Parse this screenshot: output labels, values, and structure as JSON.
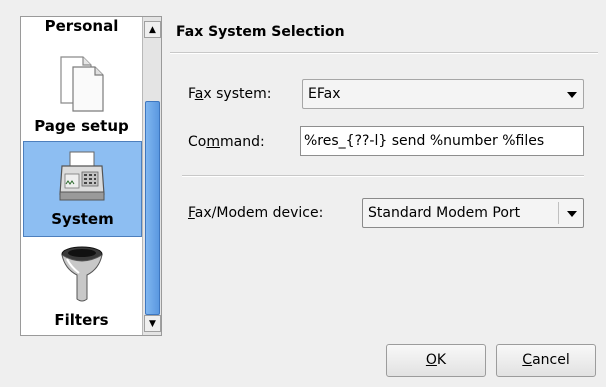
{
  "sidebar": {
    "items": [
      {
        "label": "Personal",
        "icon": "personal-icon"
      },
      {
        "label": "Page setup",
        "icon": "page-setup-icon"
      },
      {
        "label": "System",
        "icon": "fax-machine-icon",
        "selected": true
      },
      {
        "label": "Filters",
        "icon": "funnel-icon"
      }
    ]
  },
  "main": {
    "title": "Fax System Selection",
    "fax_system": {
      "label_pre": "F",
      "label_ul": "a",
      "label_post": "x system:",
      "value": "EFax"
    },
    "command": {
      "label_pre": "Co",
      "label_ul": "m",
      "label_post": "mand:",
      "value": "%res_{??-l} send %number %files"
    },
    "device": {
      "label_pre": "",
      "label_ul": "F",
      "label_post": "ax/Modem device:",
      "value": "Standard Modem Port"
    }
  },
  "buttons": {
    "ok": {
      "pre": "",
      "ul": "O",
      "post": "K"
    },
    "cancel": {
      "pre": "",
      "ul": "C",
      "post": "ancel"
    }
  },
  "colors": {
    "selection": "#8dbef2",
    "scroll_thumb": "#6aa7ea"
  }
}
